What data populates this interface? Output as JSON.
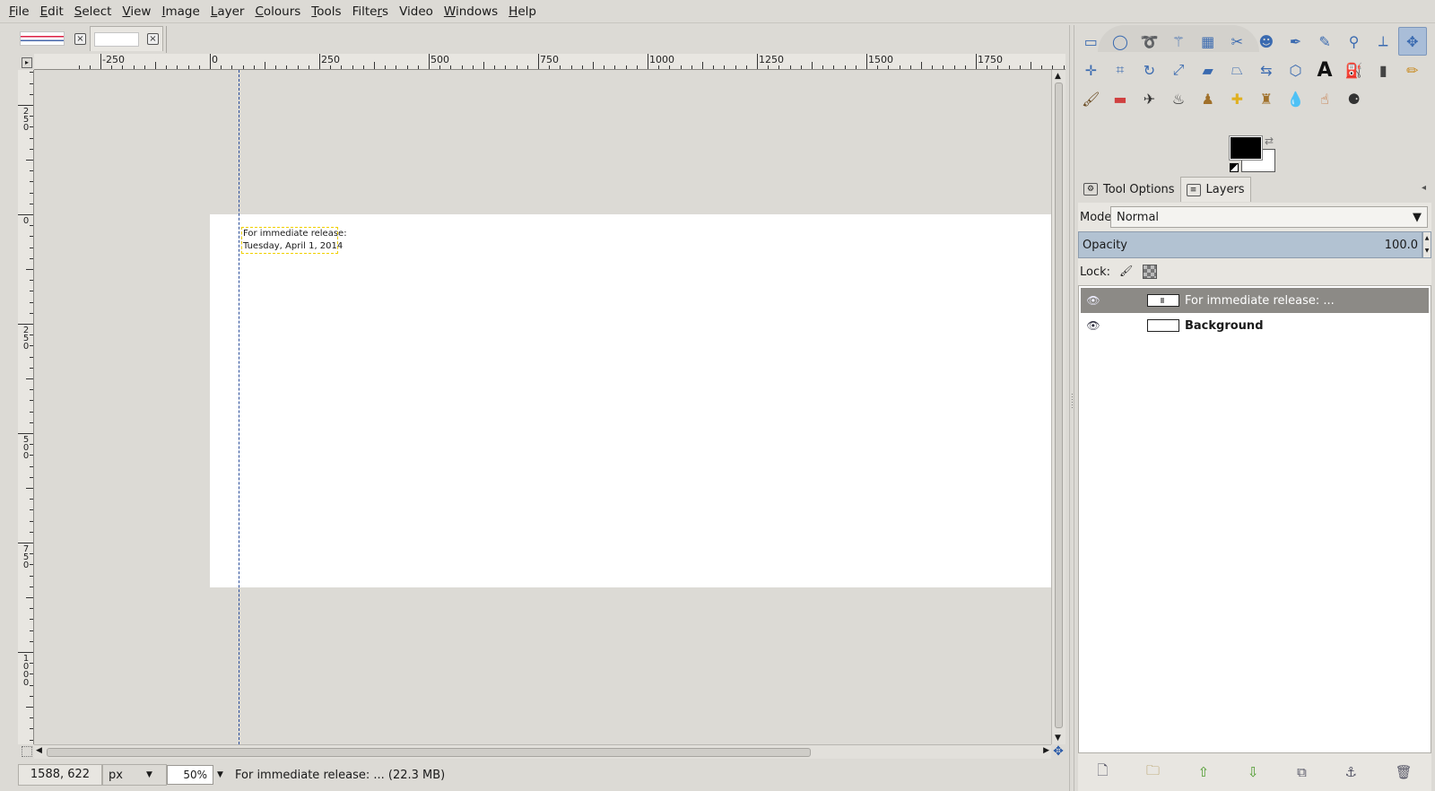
{
  "menubar": {
    "items": [
      {
        "pre": "",
        "mn": "F",
        "post": "ile"
      },
      {
        "pre": "",
        "mn": "E",
        "post": "dit"
      },
      {
        "pre": "",
        "mn": "S",
        "post": "elect"
      },
      {
        "pre": "",
        "mn": "V",
        "post": "iew"
      },
      {
        "pre": "",
        "mn": "I",
        "post": "mage"
      },
      {
        "pre": "",
        "mn": "L",
        "post": "ayer"
      },
      {
        "pre": "",
        "mn": "C",
        "post": "olours"
      },
      {
        "pre": "",
        "mn": "T",
        "post": "ools"
      },
      {
        "pre": "Filte",
        "mn": "r",
        "post": "s"
      },
      {
        "pre": "Video",
        "mn": "",
        "post": ""
      },
      {
        "pre": "",
        "mn": "W",
        "post": "indows"
      },
      {
        "pre": "",
        "mn": "H",
        "post": "elp"
      }
    ]
  },
  "image_tabs": {
    "close_glyph": "×"
  },
  "rulers": {
    "horizontal_labels": [
      "-250",
      "0",
      "250",
      "500",
      "750",
      "1000",
      "1250",
      "1500",
      "1750"
    ],
    "vertical_labels": [
      "250",
      "0",
      "250",
      "500",
      "750",
      "1000"
    ]
  },
  "canvas": {
    "text_line1": "For immediate release:",
    "text_line2": "Tuesday, April 1, 2014"
  },
  "statusbar": {
    "coords": "1588, 622",
    "unit": "px",
    "zoom": "50",
    "zoom_suffix": "%",
    "message": "For immediate release: ... (22.3 MB)"
  },
  "dock": {
    "tabs": [
      "Tool Options",
      "Layers"
    ],
    "mode_label": "Mode:",
    "mode_value": "Normal",
    "opacity_label": "Opacity",
    "opacity_value": "100.0",
    "lock_label": "Lock:",
    "layers": [
      {
        "name": "For immediate release: ...",
        "selected": true,
        "bold": false
      },
      {
        "name": "Background",
        "selected": false,
        "bold": true
      }
    ]
  },
  "colors": {
    "accent": "#3a6ab0",
    "selection": "#8c8a86",
    "opacity_bar": "#b2c2d2",
    "foreground": "#000000",
    "background": "#ffffff"
  },
  "icons": [
    "rect-select-icon",
    "ellipse-select-icon",
    "free-select-icon",
    "fuzzy-select-icon",
    "select-by-color-icon",
    "scissors-icon",
    "foreground-select-icon",
    "paths-icon",
    "color-picker-icon",
    "zoom-icon",
    "measure-icon",
    "move-icon",
    "align-icon",
    "crop-icon",
    "rotate-icon",
    "scale-icon",
    "shear-icon",
    "perspective-icon",
    "flip-icon",
    "cage-icon",
    "text-icon",
    "bucket-fill-icon",
    "blend-icon",
    "pencil-icon",
    "paintbrush-icon",
    "eraser-icon",
    "airbrush-icon",
    "ink-icon",
    "clone-icon",
    "heal-icon",
    "perspective-clone-icon",
    "blur-icon",
    "smudge-icon",
    "dodge-burn-icon"
  ]
}
